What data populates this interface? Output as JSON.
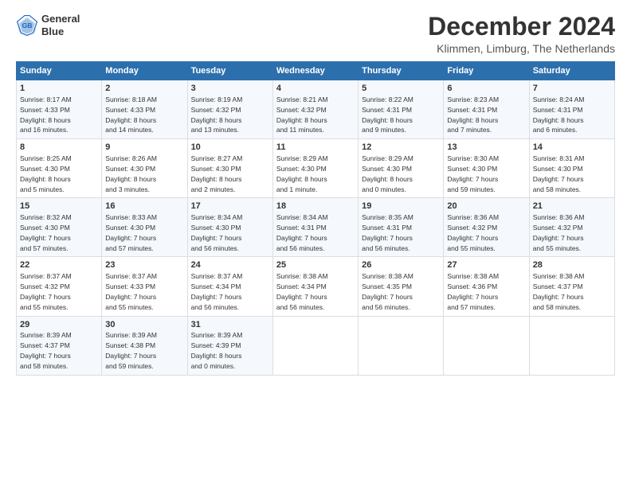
{
  "logo": {
    "line1": "General",
    "line2": "Blue"
  },
  "title": "December 2024",
  "subtitle": "Klimmen, Limburg, The Netherlands",
  "weekdays": [
    "Sunday",
    "Monday",
    "Tuesday",
    "Wednesday",
    "Thursday",
    "Friday",
    "Saturday"
  ],
  "weeks": [
    [
      {
        "day": "1",
        "detail": "Sunrise: 8:17 AM\nSunset: 4:33 PM\nDaylight: 8 hours\nand 16 minutes."
      },
      {
        "day": "2",
        "detail": "Sunrise: 8:18 AM\nSunset: 4:33 PM\nDaylight: 8 hours\nand 14 minutes."
      },
      {
        "day": "3",
        "detail": "Sunrise: 8:19 AM\nSunset: 4:32 PM\nDaylight: 8 hours\nand 13 minutes."
      },
      {
        "day": "4",
        "detail": "Sunrise: 8:21 AM\nSunset: 4:32 PM\nDaylight: 8 hours\nand 11 minutes."
      },
      {
        "day": "5",
        "detail": "Sunrise: 8:22 AM\nSunset: 4:31 PM\nDaylight: 8 hours\nand 9 minutes."
      },
      {
        "day": "6",
        "detail": "Sunrise: 8:23 AM\nSunset: 4:31 PM\nDaylight: 8 hours\nand 7 minutes."
      },
      {
        "day": "7",
        "detail": "Sunrise: 8:24 AM\nSunset: 4:31 PM\nDaylight: 8 hours\nand 6 minutes."
      }
    ],
    [
      {
        "day": "8",
        "detail": "Sunrise: 8:25 AM\nSunset: 4:30 PM\nDaylight: 8 hours\nand 5 minutes."
      },
      {
        "day": "9",
        "detail": "Sunrise: 8:26 AM\nSunset: 4:30 PM\nDaylight: 8 hours\nand 3 minutes."
      },
      {
        "day": "10",
        "detail": "Sunrise: 8:27 AM\nSunset: 4:30 PM\nDaylight: 8 hours\nand 2 minutes."
      },
      {
        "day": "11",
        "detail": "Sunrise: 8:29 AM\nSunset: 4:30 PM\nDaylight: 8 hours\nand 1 minute."
      },
      {
        "day": "12",
        "detail": "Sunrise: 8:29 AM\nSunset: 4:30 PM\nDaylight: 8 hours\nand 0 minutes."
      },
      {
        "day": "13",
        "detail": "Sunrise: 8:30 AM\nSunset: 4:30 PM\nDaylight: 7 hours\nand 59 minutes."
      },
      {
        "day": "14",
        "detail": "Sunrise: 8:31 AM\nSunset: 4:30 PM\nDaylight: 7 hours\nand 58 minutes."
      }
    ],
    [
      {
        "day": "15",
        "detail": "Sunrise: 8:32 AM\nSunset: 4:30 PM\nDaylight: 7 hours\nand 57 minutes."
      },
      {
        "day": "16",
        "detail": "Sunrise: 8:33 AM\nSunset: 4:30 PM\nDaylight: 7 hours\nand 57 minutes."
      },
      {
        "day": "17",
        "detail": "Sunrise: 8:34 AM\nSunset: 4:30 PM\nDaylight: 7 hours\nand 56 minutes."
      },
      {
        "day": "18",
        "detail": "Sunrise: 8:34 AM\nSunset: 4:31 PM\nDaylight: 7 hours\nand 56 minutes."
      },
      {
        "day": "19",
        "detail": "Sunrise: 8:35 AM\nSunset: 4:31 PM\nDaylight: 7 hours\nand 56 minutes."
      },
      {
        "day": "20",
        "detail": "Sunrise: 8:36 AM\nSunset: 4:32 PM\nDaylight: 7 hours\nand 55 minutes."
      },
      {
        "day": "21",
        "detail": "Sunrise: 8:36 AM\nSunset: 4:32 PM\nDaylight: 7 hours\nand 55 minutes."
      }
    ],
    [
      {
        "day": "22",
        "detail": "Sunrise: 8:37 AM\nSunset: 4:32 PM\nDaylight: 7 hours\nand 55 minutes."
      },
      {
        "day": "23",
        "detail": "Sunrise: 8:37 AM\nSunset: 4:33 PM\nDaylight: 7 hours\nand 55 minutes."
      },
      {
        "day": "24",
        "detail": "Sunrise: 8:37 AM\nSunset: 4:34 PM\nDaylight: 7 hours\nand 56 minutes."
      },
      {
        "day": "25",
        "detail": "Sunrise: 8:38 AM\nSunset: 4:34 PM\nDaylight: 7 hours\nand 56 minutes."
      },
      {
        "day": "26",
        "detail": "Sunrise: 8:38 AM\nSunset: 4:35 PM\nDaylight: 7 hours\nand 56 minutes."
      },
      {
        "day": "27",
        "detail": "Sunrise: 8:38 AM\nSunset: 4:36 PM\nDaylight: 7 hours\nand 57 minutes."
      },
      {
        "day": "28",
        "detail": "Sunrise: 8:38 AM\nSunset: 4:37 PM\nDaylight: 7 hours\nand 58 minutes."
      }
    ],
    [
      {
        "day": "29",
        "detail": "Sunrise: 8:39 AM\nSunset: 4:37 PM\nDaylight: 7 hours\nand 58 minutes."
      },
      {
        "day": "30",
        "detail": "Sunrise: 8:39 AM\nSunset: 4:38 PM\nDaylight: 7 hours\nand 59 minutes."
      },
      {
        "day": "31",
        "detail": "Sunrise: 8:39 AM\nSunset: 4:39 PM\nDaylight: 8 hours\nand 0 minutes."
      },
      null,
      null,
      null,
      null
    ]
  ]
}
